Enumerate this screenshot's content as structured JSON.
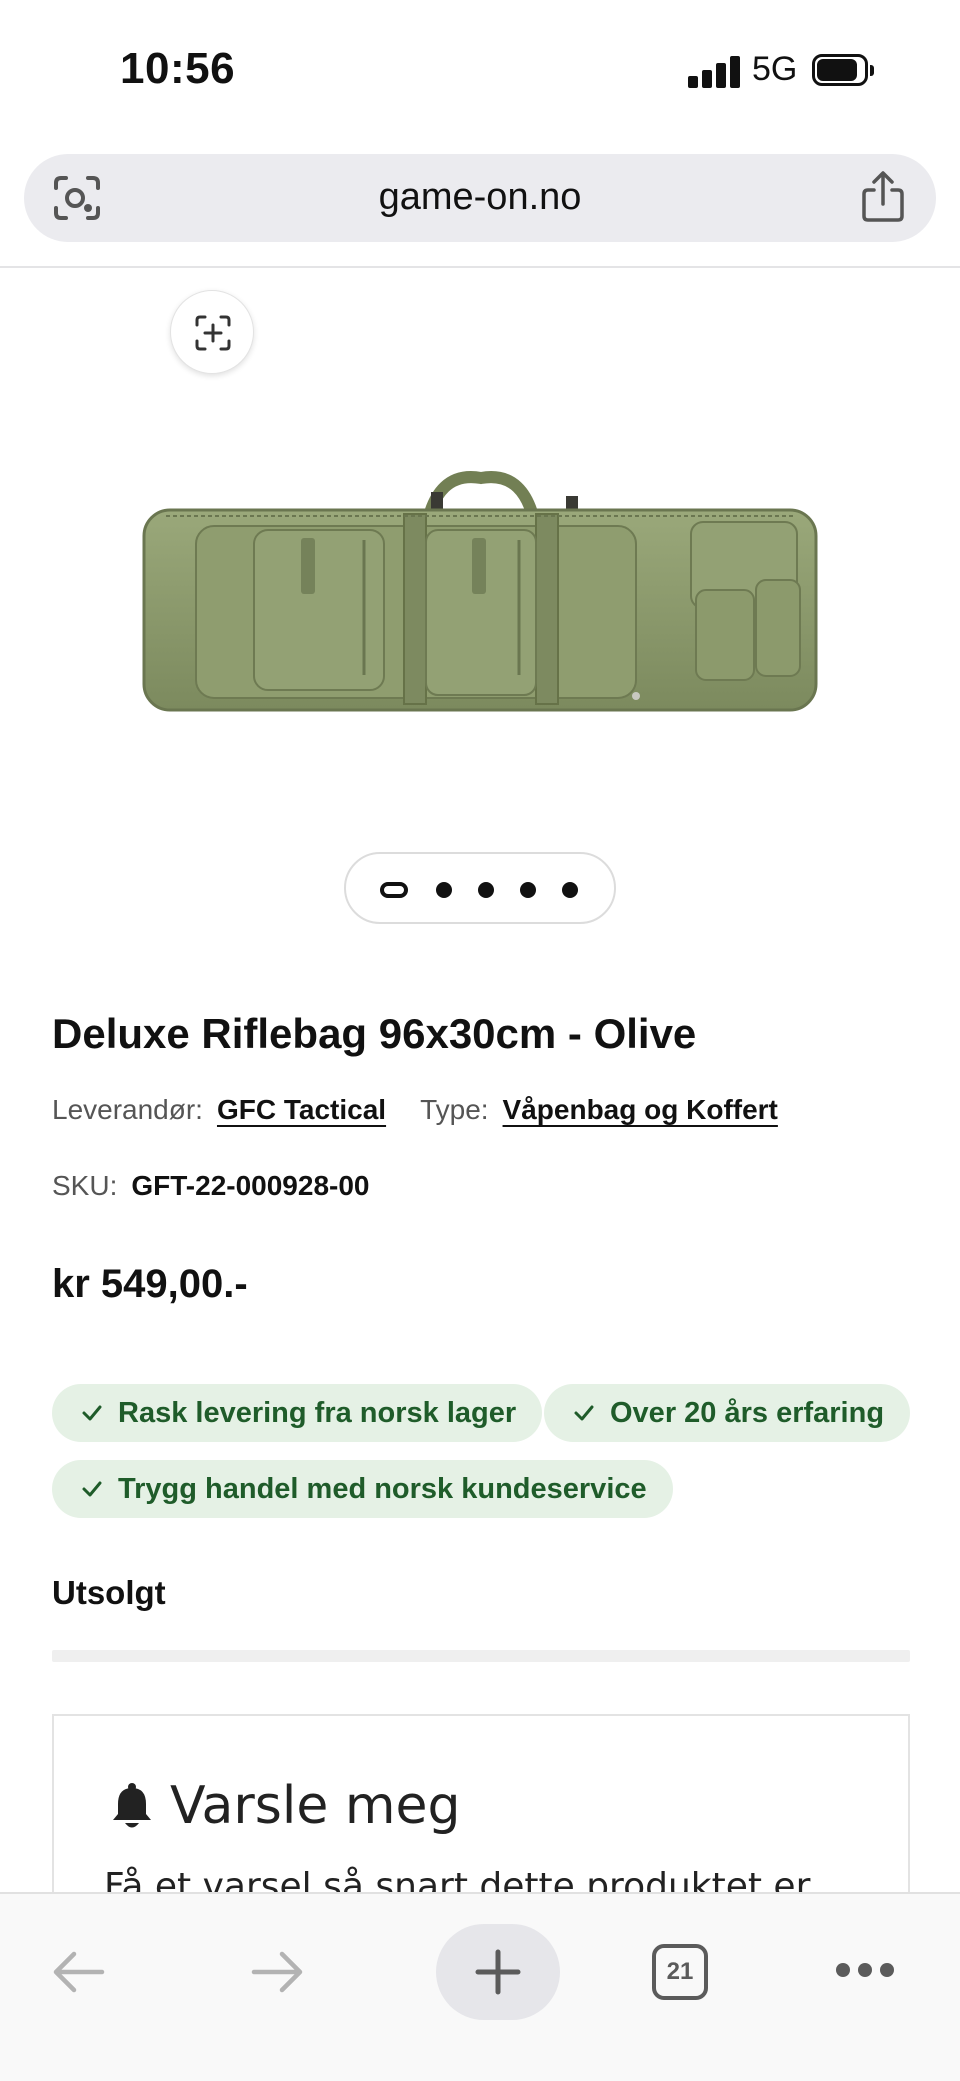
{
  "status_bar": {
    "time": "10:56",
    "network": "5G",
    "icons": [
      "signal-icon",
      "battery-icon"
    ]
  },
  "browser": {
    "url": "game-on.no",
    "icons": [
      "lens-icon",
      "share-icon"
    ]
  },
  "gallery": {
    "zoom_icon": "zoom-icon",
    "image_alt": "olive rifle bag",
    "slide_count": 5,
    "active_slide": 1
  },
  "product": {
    "title": "Deluxe Riflebag 96x30cm - Olive",
    "vendor_label": "Leverandør:",
    "vendor_value": "GFC Tactical",
    "type_label": "Type:",
    "type_value": "Våpenbag og Koffert",
    "sku_label": "SKU:",
    "sku_value": "GFT-22-000928-00",
    "price": "kr 549,00.-",
    "stock_status": "Utsolgt"
  },
  "badges": [
    "Rask levering fra norsk lager",
    "Over 20 års erfaring",
    "Trygg handel med norsk kundeservice"
  ],
  "notify": {
    "title": "Varsle meg",
    "text": "Få et varsel så snart dette produktet er"
  },
  "toolbar": {
    "tab_count": "21",
    "icons": [
      "back-arrow-icon",
      "forward-arrow-icon",
      "plus-icon",
      "tabs-icon",
      "more-icon"
    ]
  },
  "colors": {
    "badge_bg": "#e5f1e5",
    "badge_text": "#1f5c2a",
    "bag_olive": "#8a9a6a"
  }
}
